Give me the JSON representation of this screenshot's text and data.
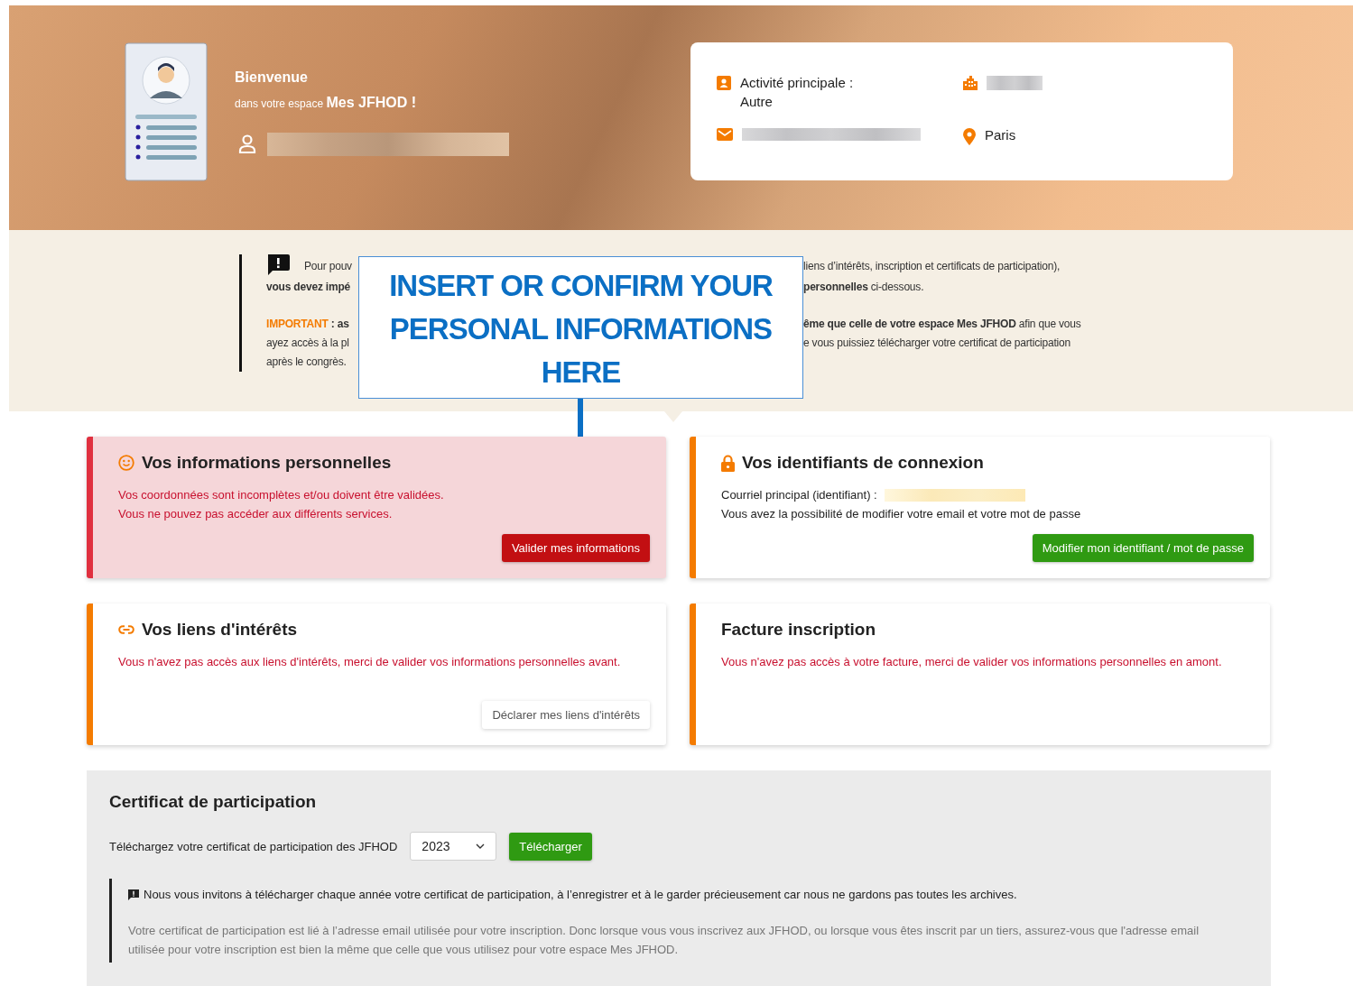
{
  "hero": {
    "welcome_title": "Bienvenue",
    "welcome_prefix": "dans votre espace",
    "space_name": "Mes JFHOD !",
    "info": {
      "activity_label": "Activité principale :",
      "activity_value": "Autre",
      "city": "Paris"
    }
  },
  "notice": {
    "lines": [
      {
        "left": "Pour pouv",
        "right": "liens d’intérêts, inscription et certificats de participation),"
      },
      {
        "left": "**vous devez impé**",
        "right": "**personnelles** ci-dessous."
      },
      {
        "lead": "IMPORTANT",
        "left": "**: as**",
        "right": "**ême que celle de votre espace Mes JFHOD** afin que vous"
      },
      {
        "left": "ayez accès à la pl",
        "right": "e vous puissiez télécharger votre certificat de participation"
      },
      {
        "left": "après le congrès."
      }
    ]
  },
  "callout": {
    "text": "INSERT OR CONFIRM YOUR PERSONAL INFORMATIONS HERE"
  },
  "cards": [
    {
      "kind": "personal",
      "error": true,
      "title": "Vos informations personnelles",
      "lines": [
        {
          "text": "Vos coordonnées sont incomplètes et/ou doivent être validées.",
          "error": true,
          "redacted": false
        },
        {
          "text": "Vous ne pouvez pas accéder aux différents services.",
          "error": true,
          "redacted": false
        }
      ],
      "button": {
        "label": "Valider mes informations",
        "kind": "danger"
      }
    },
    {
      "kind": "credentials",
      "error": false,
      "title": "Vos identifiants de connexion",
      "lines": [
        {
          "text": "Courriel principal (identifiant) :",
          "error": false,
          "redacted": true
        },
        {
          "text": "Vous avez la possibilité de modifier votre email et votre mot de passe",
          "error": false,
          "redacted": false
        }
      ],
      "button": {
        "label": "Modifier mon identifiant / mot de passe",
        "kind": "success"
      }
    },
    {
      "kind": "interests",
      "error": false,
      "title": "Vos liens d'intérêts",
      "lines": [
        {
          "text": "Vous n'avez pas accès aux liens d'intérêts, merci de valider vos informations personnelles avant.",
          "error": true,
          "redacted": false
        }
      ],
      "button": {
        "label": "Déclarer mes liens d'intérêts",
        "kind": "plain"
      }
    },
    {
      "kind": "invoice",
      "error": false,
      "title": "Facture inscription",
      "lines": [
        {
          "text": "Vous n'avez pas accès à votre facture, merci de valider vos informations personnelles en amont.",
          "error": true,
          "redacted": false
        }
      ]
    }
  ],
  "certificate": {
    "title": "Certificat de participation",
    "prompt": "Téléchargez votre certificat de participation des JFHOD",
    "year": "2023",
    "download_label": "Télécharger",
    "note": "Nous vous invitons à télécharger chaque année votre certificat de participation, à l’enregistrer et à le garder précieusement car nous ne gardons pas toutes les archives.",
    "details": "Votre certificat de participation est lié à l’adresse email utilisée pour votre inscription. Donc lorsque vous vous inscrivez aux JFHOD, ou lorsque vous êtes inscrit par un tiers, assurez-vous que l'adresse email utilisée pour votre inscription est bien la même que celle que vous utilisez pour votre espace Mes JFHOD."
  }
}
